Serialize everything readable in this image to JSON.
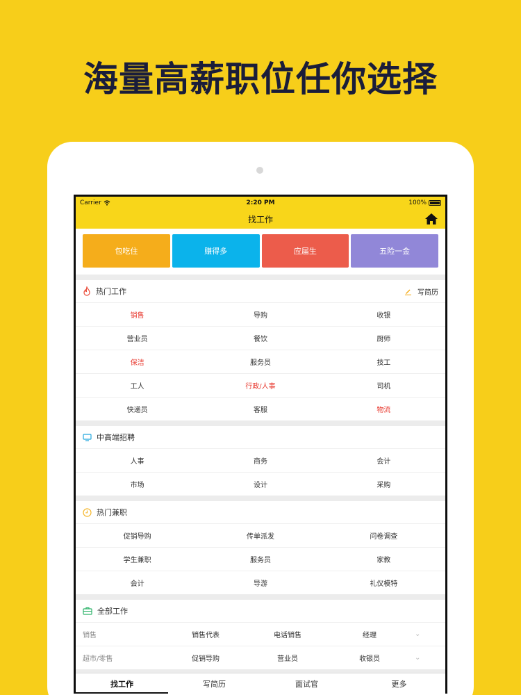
{
  "headline": "海量高薪职位任你选择",
  "status": {
    "carrier": "Carrier",
    "time": "2:20 PM",
    "battery": "100%"
  },
  "nav": {
    "title": "找工作"
  },
  "categories": [
    {
      "label": "包吃住",
      "color": "#f5ad1b"
    },
    {
      "label": "赚得多",
      "color": "#0bb3eb"
    },
    {
      "label": "应届生",
      "color": "#ec5c4b"
    },
    {
      "label": "五险一金",
      "color": "#9187d8"
    }
  ],
  "hot_jobs": {
    "title": "热门工作",
    "action": "写简历",
    "items": [
      {
        "label": "销售",
        "hot": true
      },
      {
        "label": "导购",
        "hot": false
      },
      {
        "label": "收银",
        "hot": false
      },
      {
        "label": "营业员",
        "hot": false
      },
      {
        "label": "餐饮",
        "hot": false
      },
      {
        "label": "厨师",
        "hot": false
      },
      {
        "label": "保洁",
        "hot": true
      },
      {
        "label": "服务员",
        "hot": false
      },
      {
        "label": "技工",
        "hot": false
      },
      {
        "label": "工人",
        "hot": false
      },
      {
        "label": "行政/人事",
        "hot": true
      },
      {
        "label": "司机",
        "hot": false
      },
      {
        "label": "快递员",
        "hot": false
      },
      {
        "label": "客服",
        "hot": false
      },
      {
        "label": "物流",
        "hot": true
      }
    ]
  },
  "senior_jobs": {
    "title": "中高端招聘",
    "items": [
      "人事",
      "商务",
      "会计",
      "市场",
      "设计",
      "采购"
    ]
  },
  "part_time": {
    "title": "热门兼职",
    "items": [
      "促销导购",
      "传单派发",
      "问卷调查",
      "学生兼职",
      "服务员",
      "家教",
      "会计",
      "导游",
      "礼仪模特"
    ]
  },
  "all_jobs": {
    "title": "全部工作",
    "rows": [
      {
        "category": "销售",
        "items": [
          "销售代表",
          "电话销售",
          "经理"
        ]
      },
      {
        "category": "超市/零售",
        "items": [
          "促销导购",
          "营业员",
          "收银员"
        ]
      }
    ]
  },
  "tabs": [
    {
      "label": "找工作",
      "active": true
    },
    {
      "label": "写简历",
      "active": false
    },
    {
      "label": "面试官",
      "active": false
    },
    {
      "label": "更多",
      "active": false
    }
  ],
  "colors": {
    "background": "#f7ce1a",
    "navbar": "#f8d61a",
    "hot_text": "#e8382e"
  },
  "icons": {
    "home": "home-icon",
    "hot": "flame-icon",
    "resume": "pencil-icon",
    "senior": "monitor-icon",
    "part_time": "clock-icon",
    "all": "briefcase-icon"
  }
}
